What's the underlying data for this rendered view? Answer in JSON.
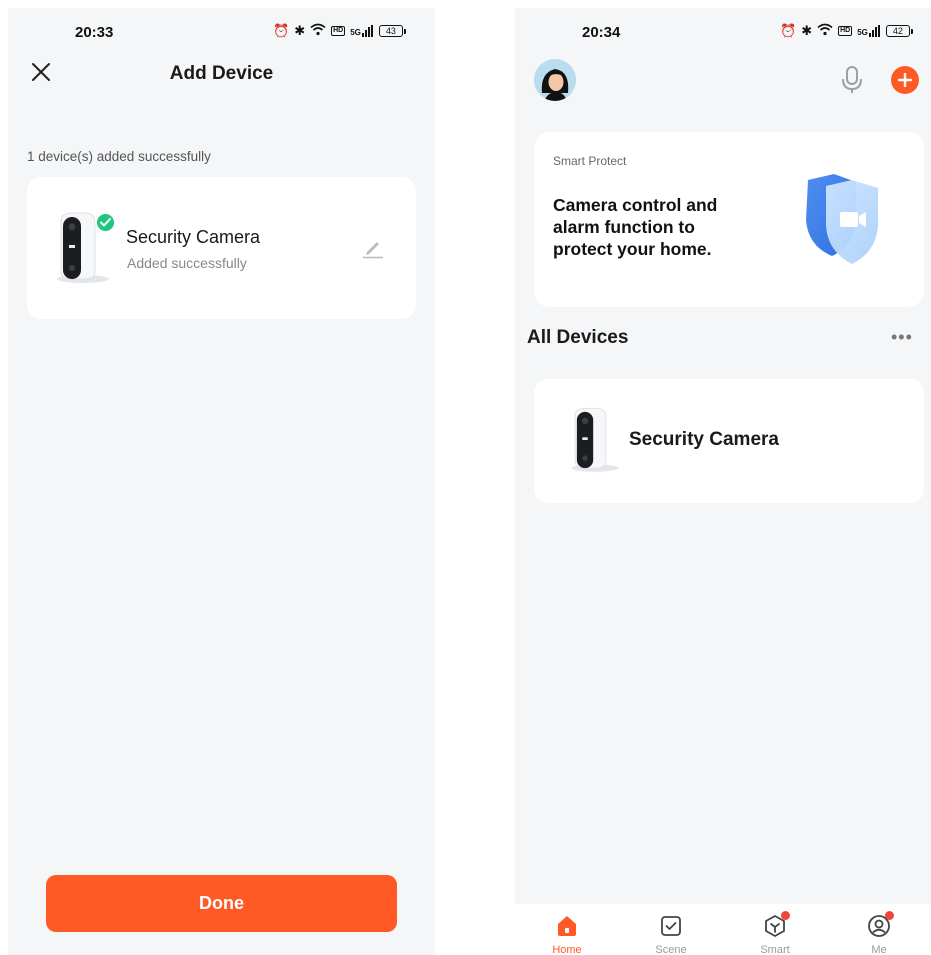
{
  "left": {
    "status": {
      "time": "20:33",
      "network": "5G",
      "battery": "43"
    },
    "header": {
      "title": "Add Device"
    },
    "summary": "1 device(s) added successfully",
    "device": {
      "name": "Security Camera",
      "status": "Added successfully"
    },
    "done_label": "Done"
  },
  "right": {
    "status": {
      "time": "20:34",
      "network": "5G",
      "battery": "42"
    },
    "promo": {
      "label": "Smart Protect",
      "text": "Camera control and\nalarm function to\nprotect your home."
    },
    "section": {
      "title": "All Devices"
    },
    "device": {
      "name": "Security Camera"
    },
    "tabs": [
      {
        "label": "Home",
        "icon": "home-icon",
        "active": true
      },
      {
        "label": "Scene",
        "icon": "scene-icon",
        "active": false
      },
      {
        "label": "Smart",
        "icon": "smart-icon",
        "active": false
      },
      {
        "label": "Me",
        "icon": "me-icon",
        "active": false
      }
    ]
  },
  "colors": {
    "accent": "#ff5a26",
    "success": "#1fc67b",
    "background": "#f4f6f8",
    "badge_dot": "#f0453a"
  }
}
